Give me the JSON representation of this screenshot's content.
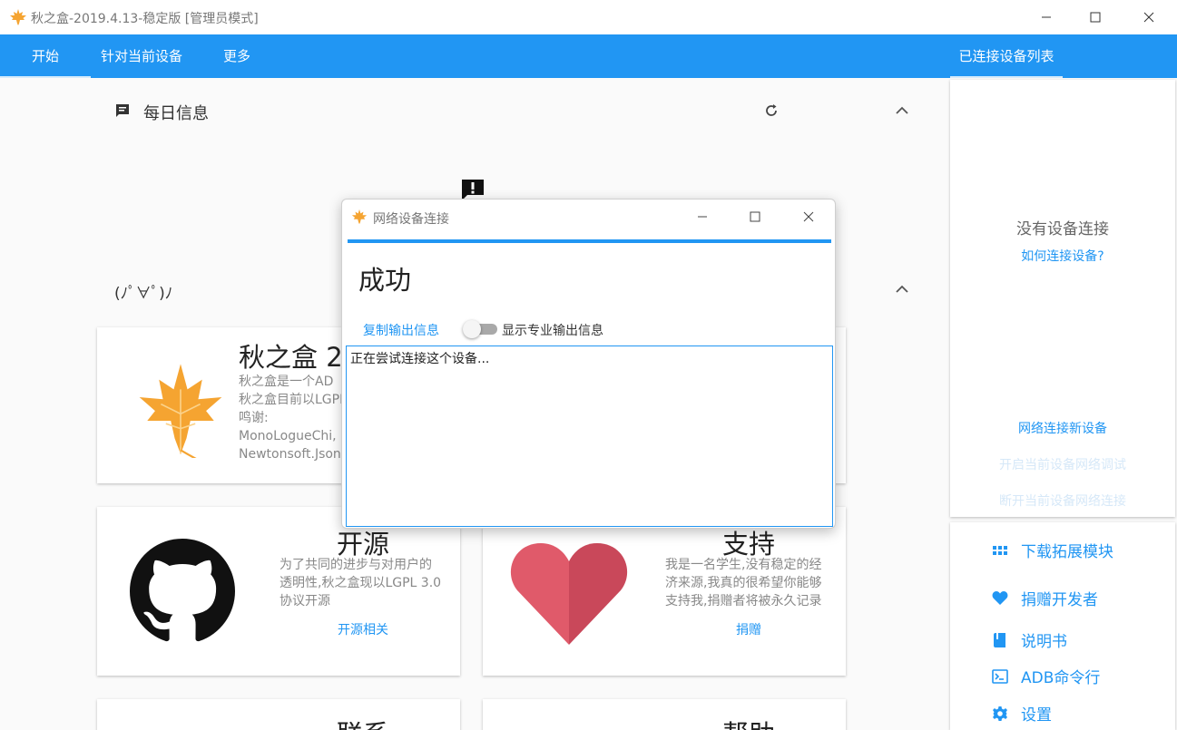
{
  "window": {
    "title": "秋之盒-2019.4.13-稳定版 [管理员模式]"
  },
  "menu": {
    "tabs": [
      {
        "label": "开始"
      },
      {
        "label": "针对当前设备"
      },
      {
        "label": "更多"
      }
    ],
    "right_tab": "已连接设备列表"
  },
  "sections": {
    "daily": {
      "label": "每日信息"
    },
    "kaomoji": {
      "label": "(ﾉﾟ∀ﾟ)ﾉ"
    }
  },
  "cards": {
    "about": {
      "title": "秋之盒 2",
      "lines": [
        "秋之盒是一个AD",
        "秋之盒目前以LGPL",
        "鸣谢:",
        "MonoLogueChi,",
        "Newtonsoft.Json"
      ]
    },
    "opensource": {
      "title": "开源",
      "text": [
        "为了共同的进步与对用户的",
        "透明性,秋之盒现以LGPL 3.0",
        "协议开源"
      ],
      "link": "开源相关"
    },
    "support": {
      "title": "支持",
      "text": [
        "我是一名学生,没有稳定的经",
        "济来源,我真的很希望你能够",
        "支持我,捐赠者将被永久记录"
      ],
      "link": "捐赠"
    },
    "contact": {
      "title": "联系"
    },
    "help": {
      "title": "帮助"
    }
  },
  "right_panel": {
    "no_device": "没有设备连接",
    "how_to": "如何连接设备?",
    "network_new": "网络连接新设备",
    "enable_net_debug": "开启当前设备网络调试",
    "disconnect_net": "断开当前设备网络连接",
    "items": [
      {
        "label": "下载拓展模块",
        "icon": "grid-icon"
      },
      {
        "label": "捐赠开发者",
        "icon": "heart-icon"
      },
      {
        "label": "说明书",
        "icon": "book-icon"
      },
      {
        "label": "ADB命令行",
        "icon": "terminal-icon"
      },
      {
        "label": "设置",
        "icon": "gear-icon"
      }
    ]
  },
  "dialog": {
    "title": "网络设备连接",
    "progress": 1.0,
    "status": "成功",
    "copy_output": "复制输出信息",
    "show_pro_output": "显示专业输出信息",
    "output": "正在尝试连接这个设备..."
  },
  "colors": {
    "accent": "#2196f3",
    "maple": "#f5a431"
  }
}
